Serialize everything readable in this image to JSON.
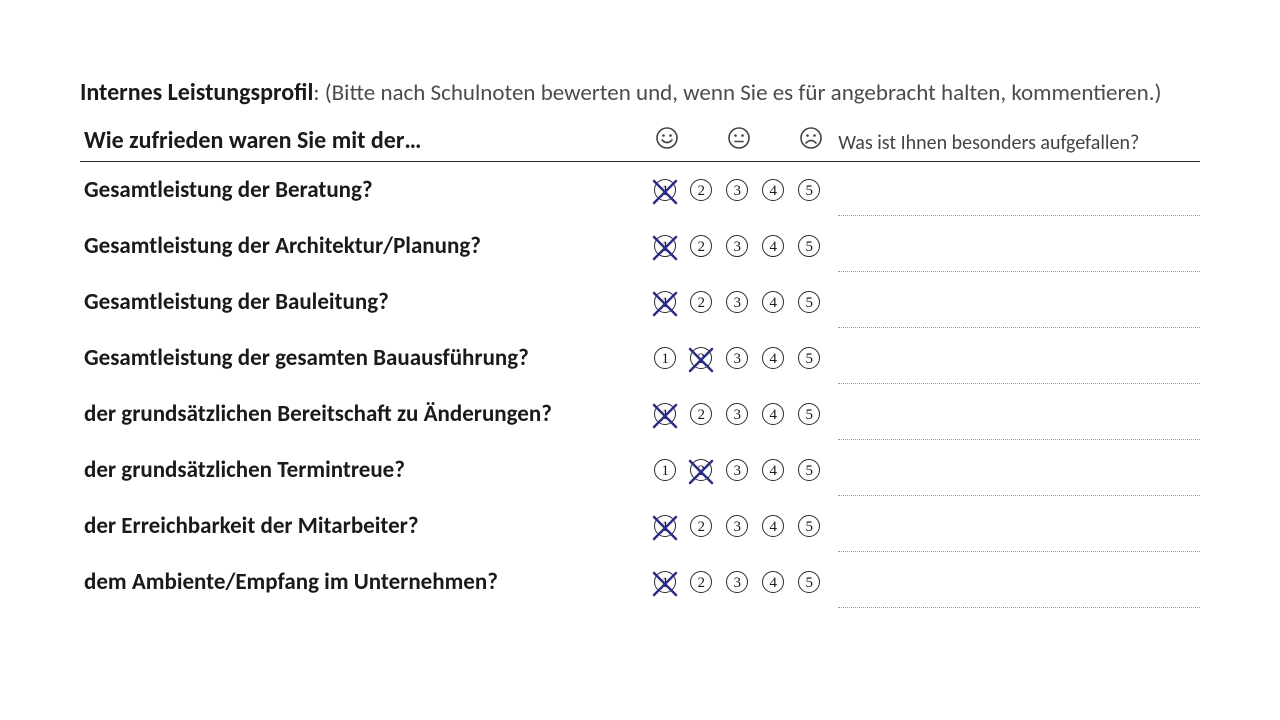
{
  "title_bold": "Internes Leistungsprofil",
  "title_rest": ": (Bitte nach Schulnoten bewerten und, wenn Sie es für angebracht halten, kommentieren.)",
  "header_question": "Wie zufrieden waren Sie mit der…",
  "header_comment": "Was ist Ihnen besonders aufgefallen?",
  "smileys": {
    "happy": "☺",
    "neutral": "😐",
    "sad": "☹"
  },
  "rating_labels": [
    "1",
    "2",
    "3",
    "4",
    "5"
  ],
  "rows": [
    {
      "label": "Gesamtleistung der Beratung?",
      "selected": 1
    },
    {
      "label": "Gesamtleistung der Architektur/Planung?",
      "selected": 1
    },
    {
      "label": "Gesamtleistung der Bauleitung?",
      "selected": 1
    },
    {
      "label": "Gesamtleistung der gesamten Bauausführung?",
      "selected": 2
    },
    {
      "label": "der grundsätzlichen Bereitschaft zu Änderungen?",
      "selected": 1
    },
    {
      "label": "der grundsätzlichen Termintreue?",
      "selected": 2
    },
    {
      "label": "der Erreichbarkeit der Mitarbeiter?",
      "selected": 1
    },
    {
      "label": "dem Ambiente/Empfang im Unternehmen?",
      "selected": 1
    }
  ]
}
